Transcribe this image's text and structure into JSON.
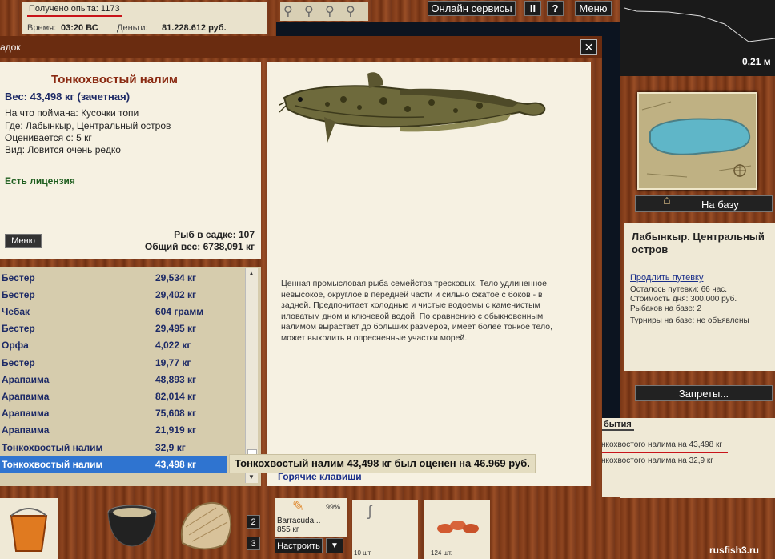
{
  "hud": {
    "exp_label": "Получено опыта: 1173",
    "time_label": "Время:",
    "time_value": "03:20 ВС",
    "money_label": "Деньги:",
    "money_value": "81.228.612 руб."
  },
  "topbar": {
    "online_services": "Онлайн сервисы",
    "pause": "II",
    "help": "?",
    "menu": "Меню"
  },
  "depth_value": "0,21 м",
  "window": {
    "title": "адок",
    "close": "✕"
  },
  "info": {
    "fish_name": "Тонкохвостый налим",
    "weight_line": "Вес: 43,498 кг (зачетная)",
    "bait_line": "На что поймана: Кусочки топи",
    "place_line": "Где: Лабынкыр, Центральный остров",
    "value_line": "Оценивается с: 5 кг",
    "rarity_line": "Вид: Ловится очень редко",
    "license": "Есть лицензия",
    "menu_button": "Меню",
    "count_line": "Рыб в садке: 107",
    "total_line": "Общий вес: 6738,091 кг"
  },
  "description": "Ценная промысловая рыба семейства тресковых. Тело удлиненное, невысокое, округлое в передней части и сильно сжатое с боков - в задней. Предпочитает холодные и чистые водоемы с каменистым иловатым дном и ключевой водой. По сравнению с обыкновенным налимом вырастает до больших размеров, имеет более тонкое тело, может выходить в опресненные участки морей.",
  "fish_list": [
    {
      "name": "Бестер",
      "weight": "29,534 кг"
    },
    {
      "name": "Бестер",
      "weight": "29,402 кг"
    },
    {
      "name": "Чебак",
      "weight": "604 грамм"
    },
    {
      "name": "Бестер",
      "weight": "29,495 кг"
    },
    {
      "name": "Орфа",
      "weight": "4,022 кг"
    },
    {
      "name": "Бестер",
      "weight": "19,77 кг"
    },
    {
      "name": "Арапаима",
      "weight": "48,893 кг"
    },
    {
      "name": "Арапаима",
      "weight": "82,014 кг"
    },
    {
      "name": "Арапаима",
      "weight": "75,608 кг"
    },
    {
      "name": "Арапаима",
      "weight": "21,919 кг"
    },
    {
      "name": "Тонкохвостый налим",
      "weight": "32,9 кг"
    },
    {
      "name": "Тонкохвостый налим",
      "weight": "43,498 кг"
    }
  ],
  "selected_index": 11,
  "tooltip": "Тонкохвостый налим 43,498 кг был оценен на 46.969 руб.",
  "hotkeys_link": "Горячие клавиши",
  "right": {
    "base_button": "На базу",
    "location_title": "Лабынкыр. Центральный остров",
    "extend_link": "Продлить путевку",
    "days_left": "Осталось путевки: 66 час.",
    "day_cost": "Стоимость дня: 300.000 руб.",
    "anglers": "Рыбаков на базе: 2",
    "tournaments": "Турниры на базе: не объявлены",
    "bans_button": "Запреты...",
    "events_tab": "бытия",
    "event1": "нкохвостого налима на 43,498 кг",
    "event2": "нкохвостого налима на 32,9 кг"
  },
  "bottom": {
    "slot2": "2",
    "slot3": "3",
    "lure_name": "Barracuda...",
    "lure_weight": "855 кг",
    "lure_percent": "99%",
    "setup_button": "Настроить",
    "setup_arrow": "▼",
    "item1_count": "10 шт.",
    "item2_count": "124 шт."
  },
  "watermark": "rusfish3.ru"
}
